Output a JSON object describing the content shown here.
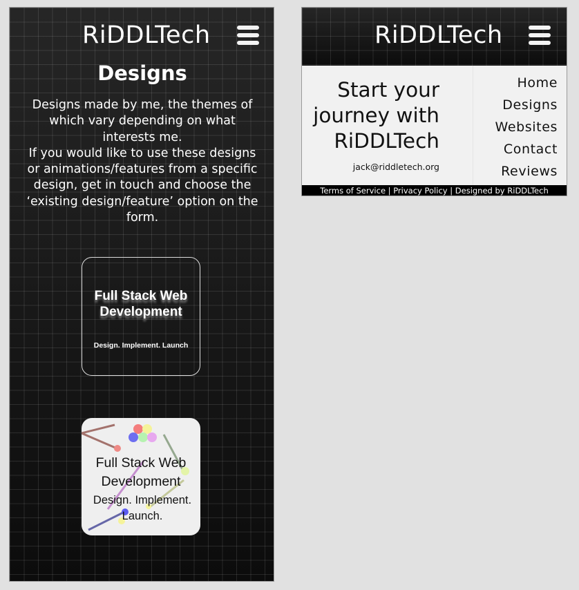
{
  "mobile_page": {
    "brand": "RiDDLTech",
    "heading": "Designs",
    "description_lines": [
      "Designs made by me, the themes of which vary depending on what interests me.",
      "If you would like to use these designs or animations/features from a specific design, get in touch and choose the ‘existing design/feature’ option on the form."
    ],
    "cards": [
      {
        "title": "Full Stack Web Development",
        "subtitle": "Design. Implement. Launch"
      },
      {
        "title": "Full Stack Web Development",
        "subtitle": "Design.   Implement. Launch."
      }
    ]
  },
  "menu_page": {
    "brand": "RiDDLTech",
    "tagline": "Start your journey with RiDDLTech",
    "email": "jack@riddletech.org",
    "nav": [
      "Home",
      "Designs",
      "Websites",
      "Contact",
      "Reviews"
    ],
    "footer": {
      "terms": "Terms of Service",
      "privacy": "Privacy Policy",
      "credit": "Designed by RiDDLTech",
      "separator": "|"
    }
  },
  "icons": [
    "hamburger-menu-icon"
  ],
  "colors": {
    "background": "#e1e1e1",
    "panel_dark": "#111111",
    "panel_light": "#f1f1f1",
    "card_light": "#efefef",
    "text_light": "#ffffff",
    "text_dark": "#111111",
    "footer_bg": "#000000"
  }
}
